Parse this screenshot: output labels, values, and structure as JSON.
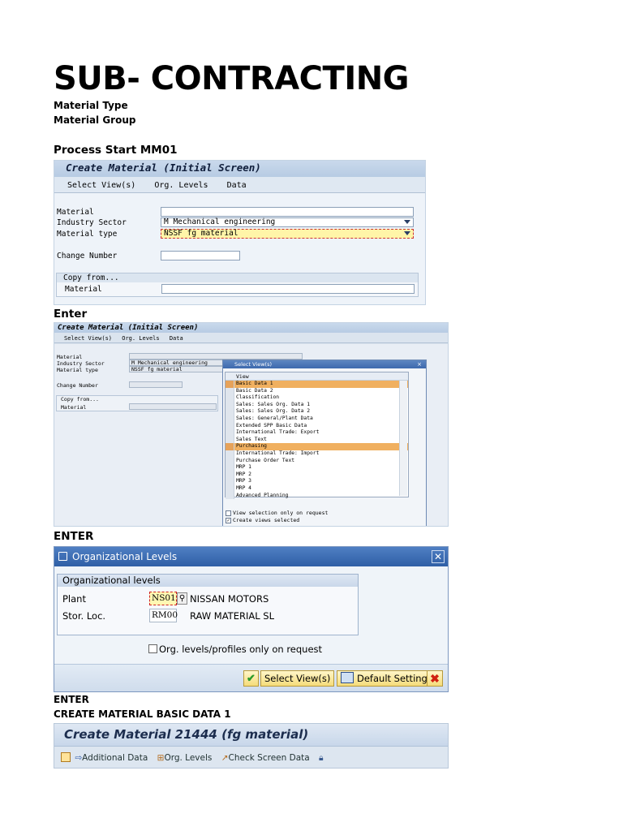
{
  "doc": {
    "title": "SUB- CONTRACTING",
    "material_type": "Material Type",
    "material_group": "Material Group",
    "process_start": "Process Start MM01",
    "enter1": "Enter",
    "enter2": "ENTER",
    "enter3": "ENTER",
    "create_basic": "CREATE MATERIAL BASIC DATA 1"
  },
  "screen1": {
    "title": "Create Material (Initial Screen)",
    "menu": [
      "Select View(s)",
      "Org. Levels",
      "Data"
    ],
    "material_label": "Material",
    "industry_label": "Industry Sector",
    "industry_value": "M Mechanical engineering",
    "mattype_label": "Material type",
    "mattype_value": "NSSF fg material",
    "change_label": "Change Number",
    "copy_group": "Copy from...",
    "copy_material_label": "Material"
  },
  "screen2": {
    "title": "Create Material (Initial Screen)",
    "menu": [
      "Select View(s)",
      "Org. Levels",
      "Data"
    ],
    "material_label": "Material",
    "industry_label": "Industry Sector",
    "industry_value": "M Mechanical engineering",
    "mattype_label": "Material type",
    "mattype_value": "NSSF fg material",
    "change_label": "Change Number",
    "copy_group": "Copy from...",
    "copy_material_label": "Material",
    "popup_title": "Select View(s)",
    "popup_close": "×",
    "list_header": "View",
    "views": [
      {
        "label": "Basic Data 1",
        "hl": true
      },
      {
        "label": "Basic Data 2",
        "hl": false
      },
      {
        "label": "Classification",
        "hl": false
      },
      {
        "label": "Sales: Sales Org. Data 1",
        "hl": false
      },
      {
        "label": "Sales: Sales Org. Data 2",
        "hl": false
      },
      {
        "label": "Sales: General/Plant Data",
        "hl": false
      },
      {
        "label": "Extended SPP Basic Data",
        "hl": false
      },
      {
        "label": "International Trade: Export",
        "hl": false
      },
      {
        "label": "Sales Text",
        "hl": false
      },
      {
        "label": "Purchasing",
        "hl": true
      },
      {
        "label": "International Trade: Import",
        "hl": false
      },
      {
        "label": "Purchase Order Text",
        "hl": false
      },
      {
        "label": "MRP 1",
        "hl": false
      },
      {
        "label": "MRP 2",
        "hl": false
      },
      {
        "label": "MRP 3",
        "hl": false
      },
      {
        "label": "MRP 4",
        "hl": false
      },
      {
        "label": "Advanced Planning",
        "hl": false
      }
    ],
    "opt1": "View selection only on request",
    "opt2": "Create views selected"
  },
  "screen3": {
    "title": "Organizational Levels",
    "group": "Organizational levels",
    "plant_label": "Plant",
    "plant_value": "NS01",
    "plant_desc": "NISSAN MOTORS",
    "sloc_label": "Stor. Loc.",
    "sloc_value": "RM00",
    "sloc_desc": "RAW MATERIAL SL",
    "checkbox_label": "Org. levels/profiles only on request",
    "btn_select": "Select View(s)",
    "btn_default": "Default Setting"
  },
  "screen4": {
    "title": "Create Material 21444 (fg material)",
    "toolbar": [
      "Additional Data",
      "Org. Levels",
      "Check Screen Data"
    ]
  }
}
